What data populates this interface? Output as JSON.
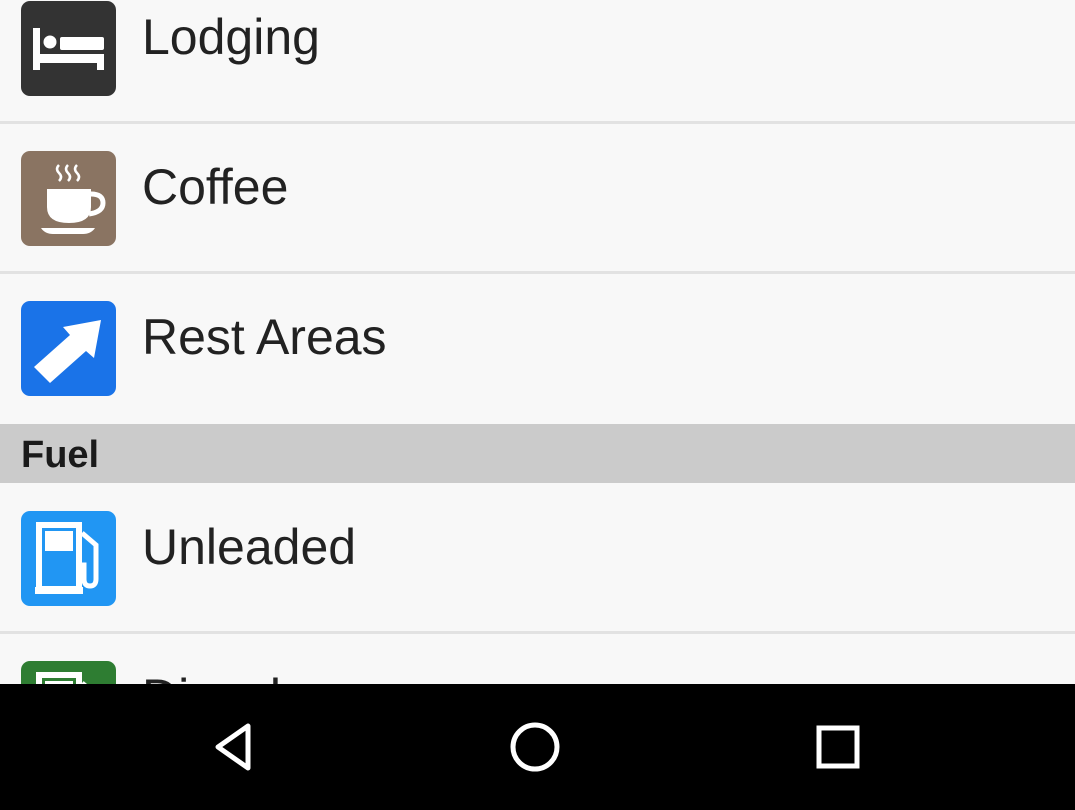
{
  "amenities": {
    "lodging": {
      "label": "Lodging",
      "icon": "bed-icon",
      "color": "#333333"
    },
    "coffee": {
      "label": "Coffee",
      "icon": "coffee-cup-icon",
      "color": "#8a7462"
    },
    "rest_areas": {
      "label": "Rest Areas",
      "icon": "arrow-up-right-icon",
      "color": "#1a73e8"
    }
  },
  "fuel_section": {
    "title": "Fuel",
    "items": {
      "unleaded": {
        "label": "Unleaded",
        "icon": "gas-pump-icon",
        "color": "#2196f3"
      },
      "diesel": {
        "label": "Diesel",
        "icon": "diesel-pump-icon",
        "color": "#2e7d32"
      }
    }
  },
  "navigation_bar": {
    "back": "back-icon",
    "home": "home-icon",
    "recents": "recents-icon"
  }
}
